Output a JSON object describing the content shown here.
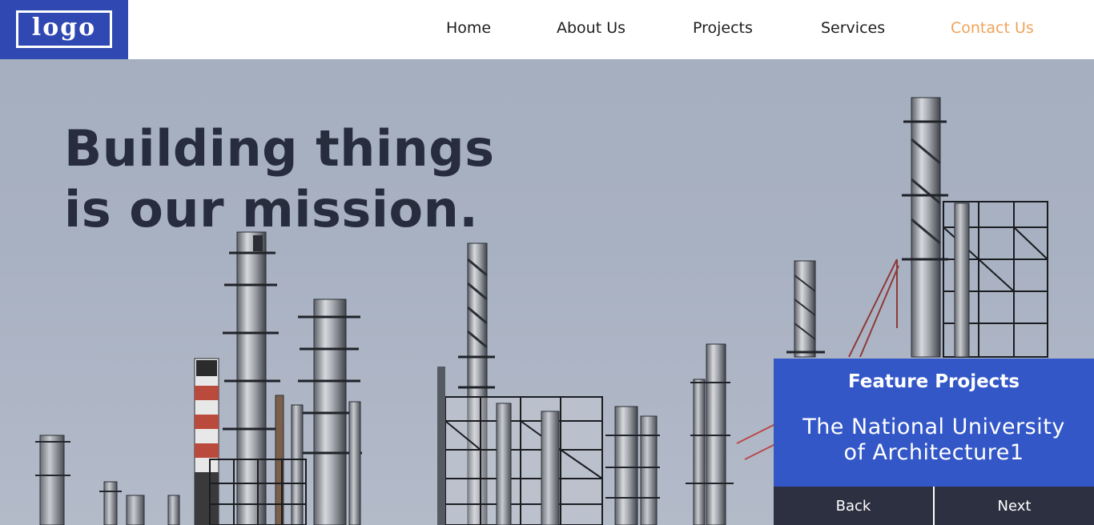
{
  "header": {
    "logo_text": "logo",
    "nav": [
      "Home",
      "About Us",
      "Projects",
      "Services",
      "Contact Us"
    ],
    "active_index": 4
  },
  "hero": {
    "headline_line1": "Building things",
    "headline_line2": "is our mission."
  },
  "feature": {
    "title": "Feature Projects",
    "project_line1": "The National University",
    "project_line2": "of Architecture1",
    "back_label": "Back",
    "next_label": "Next"
  },
  "colors": {
    "brand_blue": "#3048b2",
    "panel_blue": "#3457c8",
    "accent_orange": "#f0a35a",
    "dark": "#2d3040"
  }
}
